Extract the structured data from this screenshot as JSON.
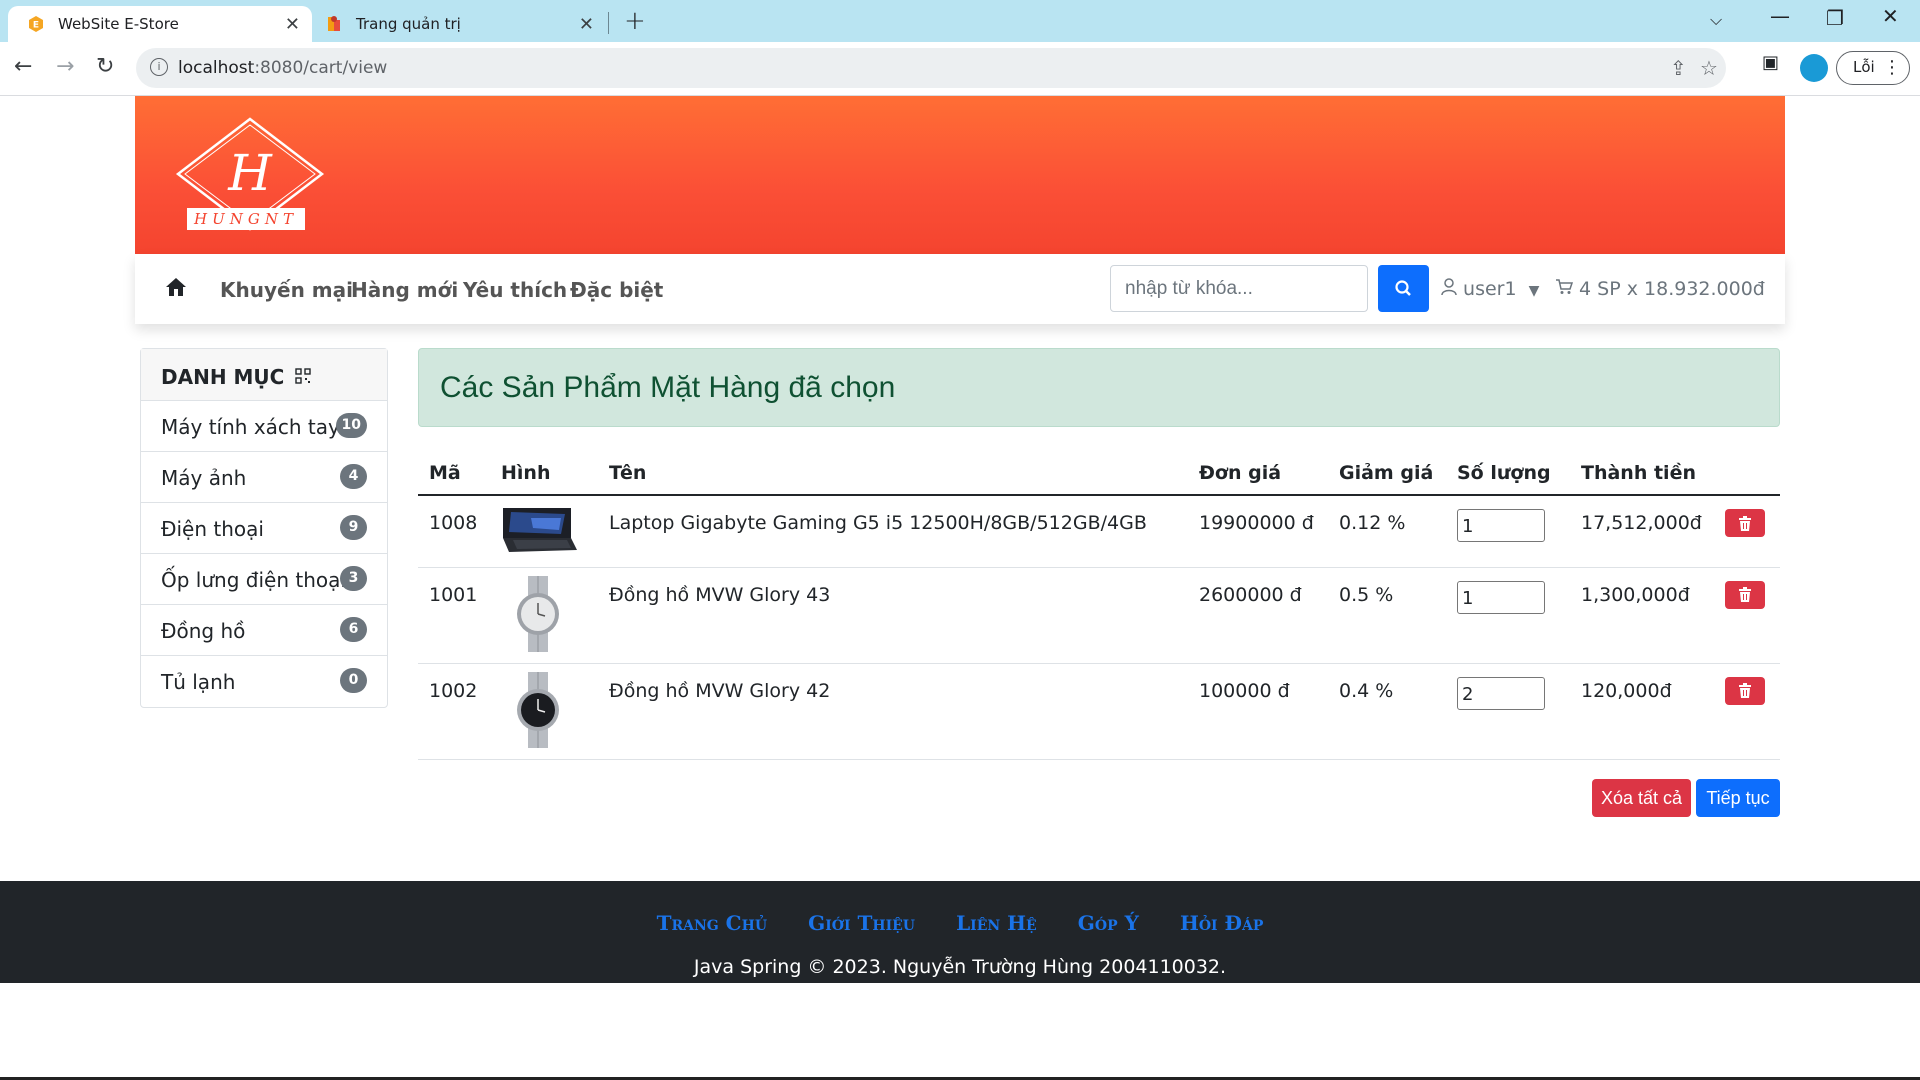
{
  "browser": {
    "tabs": [
      {
        "title": "WebSite E-Store",
        "active": true
      },
      {
        "title": "Trang quản trị",
        "active": false
      }
    ],
    "url_host": "localhost",
    "url_rest": ":8080/cart/view",
    "error_label": "Lỗi"
  },
  "nav": {
    "links": [
      "Khuyến mại",
      "Hàng mới",
      "Yêu thích",
      "Đặc biệt"
    ],
    "search_placeholder": "nhập từ khóa...",
    "user": "user1",
    "cart_summary": "4 SP x 18.932.000đ"
  },
  "logo": {
    "letter": "H",
    "text": "HUNGNT"
  },
  "sidebar": {
    "title": "DANH MỤC",
    "items": [
      {
        "label": "Máy tính xách tay",
        "count": "10"
      },
      {
        "label": "Máy ảnh",
        "count": "4"
      },
      {
        "label": "Điện thoại",
        "count": "9"
      },
      {
        "label": "Ốp lưng điện thoại",
        "count": "3"
      },
      {
        "label": "Đồng hồ",
        "count": "6"
      },
      {
        "label": "Tủ lạnh",
        "count": "0"
      }
    ]
  },
  "cart": {
    "title": "Các Sản Phẩm Mặt Hàng đã chọn",
    "columns": [
      "Mã",
      "Hình",
      "Tên",
      "Đơn giá",
      "Giảm giá",
      "Số lượng",
      "Thành tiền"
    ],
    "rows": [
      {
        "id": "1008",
        "name": "Laptop Gigabyte Gaming G5 i5 12500H/8GB/512GB/4GB",
        "price": "19900000 đ",
        "discount": "0.12 %",
        "qty": "1",
        "total": "17,512,000đ",
        "image": "laptop"
      },
      {
        "id": "1001",
        "name": "Đồng hồ MVW Glory 43",
        "price": "2600000 đ",
        "discount": "0.5 %",
        "qty": "1",
        "total": "1,300,000đ",
        "image": "watch-silver"
      },
      {
        "id": "1002",
        "name": "Đồng hồ MVW Glory 42",
        "price": "100000 đ",
        "discount": "0.4 %",
        "qty": "2",
        "total": "120,000đ",
        "image": "watch-black"
      }
    ],
    "clear_all": "Xóa tất cả",
    "continue": "Tiếp tục"
  },
  "footer": {
    "links": [
      "Trang Chủ",
      "Giới Thiệu",
      "Liên Hệ",
      "Góp Ý",
      "Hỏi Đáp"
    ],
    "copyright": "Java Spring © 2023. Nguyễn Trường Hùng 2004110032."
  },
  "colors": {
    "primary": "#0d6efd",
    "danger": "#dc3545",
    "header": "#f4442f",
    "footer": "#212529"
  }
}
